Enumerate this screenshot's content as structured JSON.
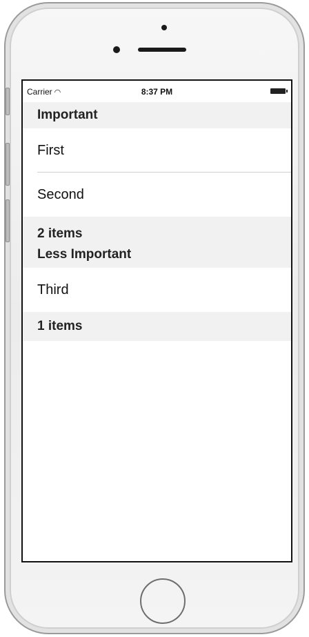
{
  "status_bar": {
    "carrier": "Carrier",
    "wifi_icon": "wifi-icon",
    "time": "8:37 PM",
    "battery_icon": "battery-icon"
  },
  "table": {
    "sections": [
      {
        "header": "Important",
        "rows": [
          "First",
          "Second"
        ],
        "footer": "2 items"
      },
      {
        "header": "Less Important",
        "rows": [
          "Third"
        ],
        "footer": "1 items"
      }
    ]
  },
  "device": {
    "home_button_icon": "home-button"
  }
}
